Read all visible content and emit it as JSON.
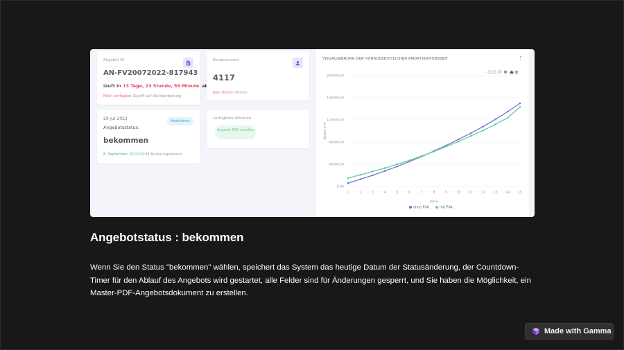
{
  "screenshot": {
    "card_offer": {
      "label": "Angebot ID",
      "offer_id": "AN-FV20072022-817943",
      "countdown_prefix": "läuft in",
      "countdown": "13 Tage, 23 Stunde, 59 Minute",
      "countdown_suffix": "ab.",
      "not_available": "Nicht verfügbar",
      "edit_access": "Zugriff auf die Bearbeitung",
      "icon": "document-icon"
    },
    "card_customer": {
      "label": "Kundennumer",
      "number": "4117",
      "no_appointment": "Kein Termin",
      "appointment": "Termin",
      "icon": "user-icon"
    },
    "card_status": {
      "date": "20-Jul-2022",
      "label": "Angebotsstatus:",
      "status": "bekommen",
      "finalize_button": "finalisieren",
      "changed_date": "8. September 2023 09:45",
      "changed_label": "Änderungsdatum"
    },
    "card_actions": {
      "label": "verfügbare Aktionen",
      "pdf_button": "Angebot PDF erstellen"
    },
    "chart_panel": {
      "title": "VISUALISIERUNG DER VORAUSSICHTLICHEN AMORTISATIONSZEIT",
      "menu_icon": "more-vertical-icon",
      "toolbar_icons": [
        "zoom-in-icon",
        "zoom-out-icon",
        "magnify-icon",
        "pan-hand-icon",
        "home-icon",
        "menu-icon"
      ]
    }
  },
  "chart_data": {
    "type": "line",
    "x": [
      1,
      2,
      3,
      4,
      5,
      6,
      7,
      8,
      9,
      10,
      11,
      12,
      13,
      14,
      15
    ],
    "xlabel": "Jahre",
    "ylabel": "Kosten in €",
    "yticks": [
      "0,00",
      "40000,00",
      "80000,00",
      "120000,00",
      "160000,00",
      "200000,00"
    ],
    "ylim": [
      0,
      200000
    ],
    "grid": true,
    "legend_position": "bottom",
    "series": [
      {
        "name": "ohne PVA",
        "color": "#7b6fe0",
        "values": [
          6000,
          13000,
          20000,
          28000,
          36000,
          45000,
          54000,
          64000,
          74000,
          85000,
          96000,
          108000,
          121000,
          135000,
          150000
        ]
      },
      {
        "name": "mit PVA",
        "color": "#5fd08f",
        "values": [
          15000,
          21000,
          27000,
          33000,
          40000,
          47000,
          55000,
          63000,
          72000,
          81000,
          91000,
          101000,
          112000,
          124000,
          143000
        ]
      }
    ]
  },
  "slide": {
    "heading": "Angebotstatus :  bekommen",
    "body": "Wenn Sie den Status \"bekommen\" wählen, speichert das System das heutige Datum der Statusänderung, der Countdown-Timer für den Ablauf des Angebots wird gestartet, alle Felder sind für Änderungen gesperrt, und Sie haben die Möglichkeit, ein Master-PDF-Angebotsdokument zu erstellen.",
    "badge": "Made with Gamma",
    "badge_icon": "gamma-logo-icon"
  }
}
